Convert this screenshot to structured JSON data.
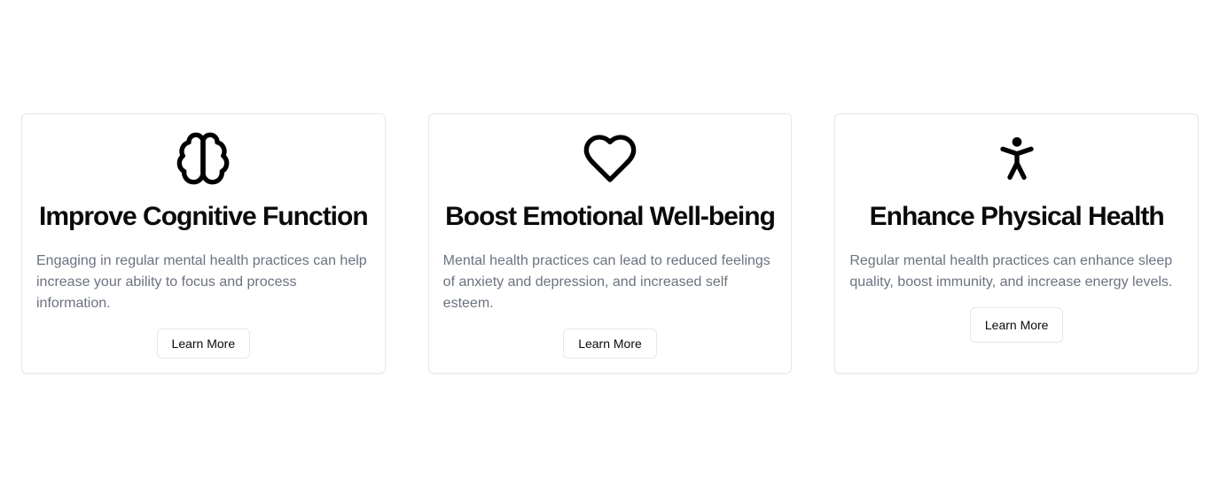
{
  "cards": [
    {
      "icon": "brain-icon",
      "title": "Improve Cognitive Function",
      "description": "Engaging in regular mental health practices can help increase your ability to focus and process information.",
      "button_label": "Learn More"
    },
    {
      "icon": "heart-icon",
      "title": "Boost Emotional Well-being",
      "description": "Mental health practices can lead to reduced feelings of anxiety and depression, and increased self esteem.",
      "button_label": "Learn More"
    },
    {
      "icon": "accessibility-person-icon",
      "title": "Enhance Physical Health",
      "description": "Regular mental health practices can enhance sleep quality, boost immunity, and increase energy levels.",
      "button_label": "Learn More"
    }
  ],
  "colors": {
    "title": "#0a0a0a",
    "description": "#6b7280",
    "border": "#e5e7eb"
  }
}
